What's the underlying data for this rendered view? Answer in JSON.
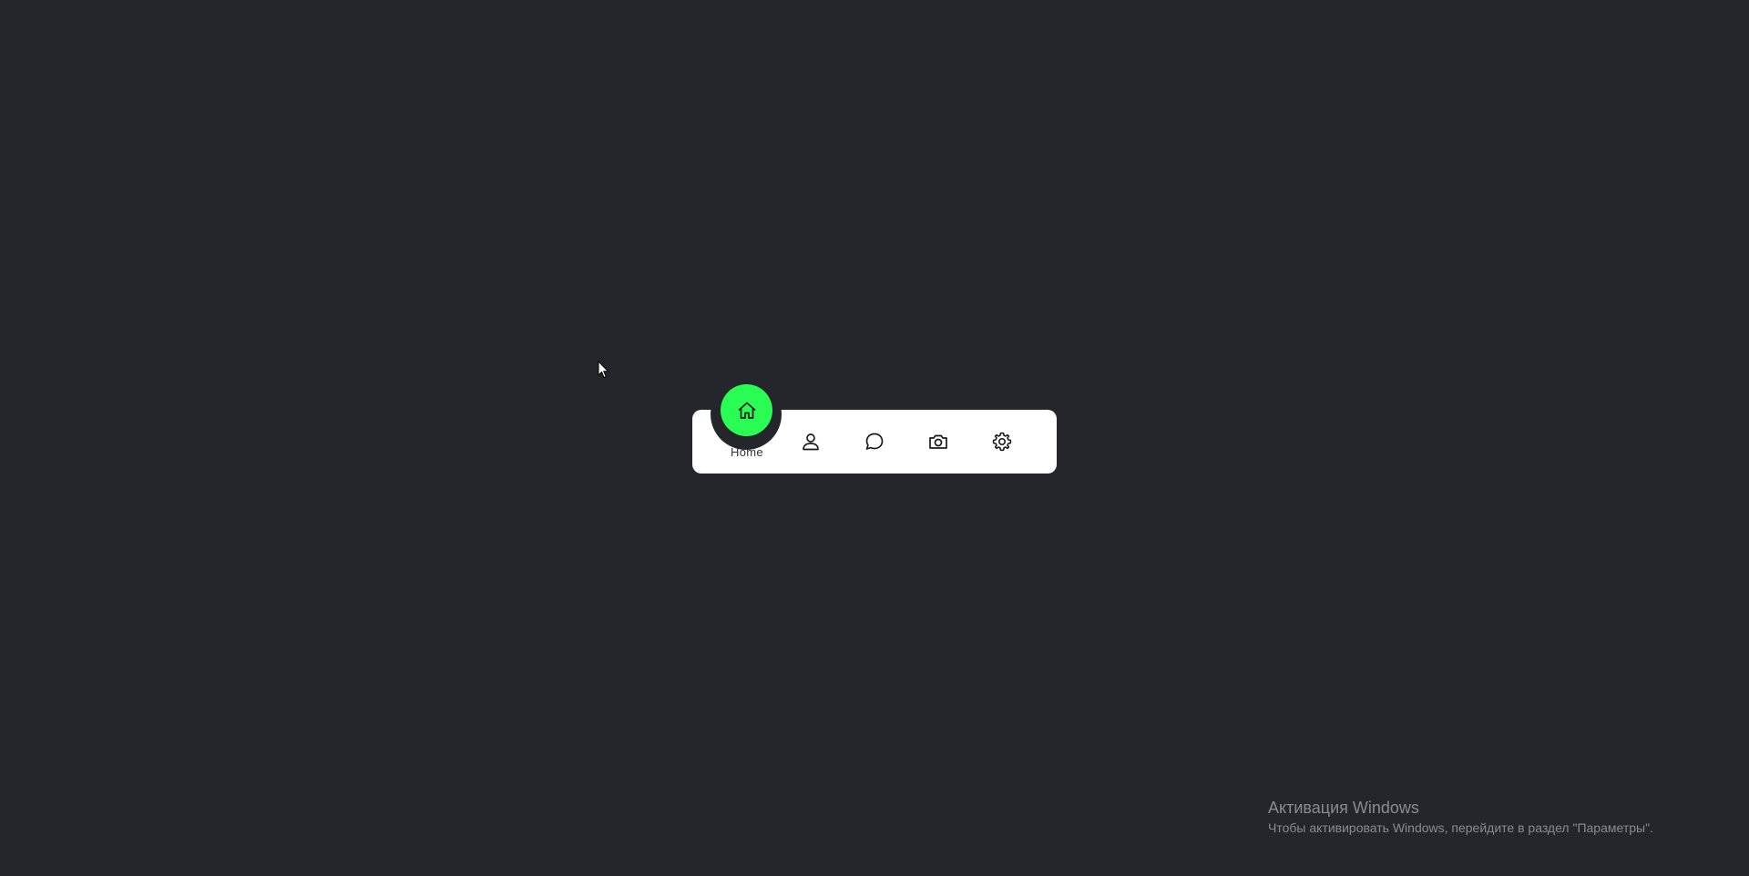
{
  "nav": {
    "items": [
      {
        "label": "Home",
        "icon": "home-icon",
        "active": true
      },
      {
        "label": "",
        "icon": "person-icon",
        "active": false
      },
      {
        "label": "",
        "icon": "chat-icon",
        "active": false
      },
      {
        "label": "",
        "icon": "camera-icon",
        "active": false
      },
      {
        "label": "",
        "icon": "settings-icon",
        "active": false
      }
    ],
    "active_color": "#29fd53",
    "bar_color": "#ffffff",
    "background_color": "#25262b"
  },
  "watermark": {
    "title": "Активация Windows",
    "subtitle": "Чтобы активировать Windows, перейдите в раздел \"Параметры\"."
  }
}
